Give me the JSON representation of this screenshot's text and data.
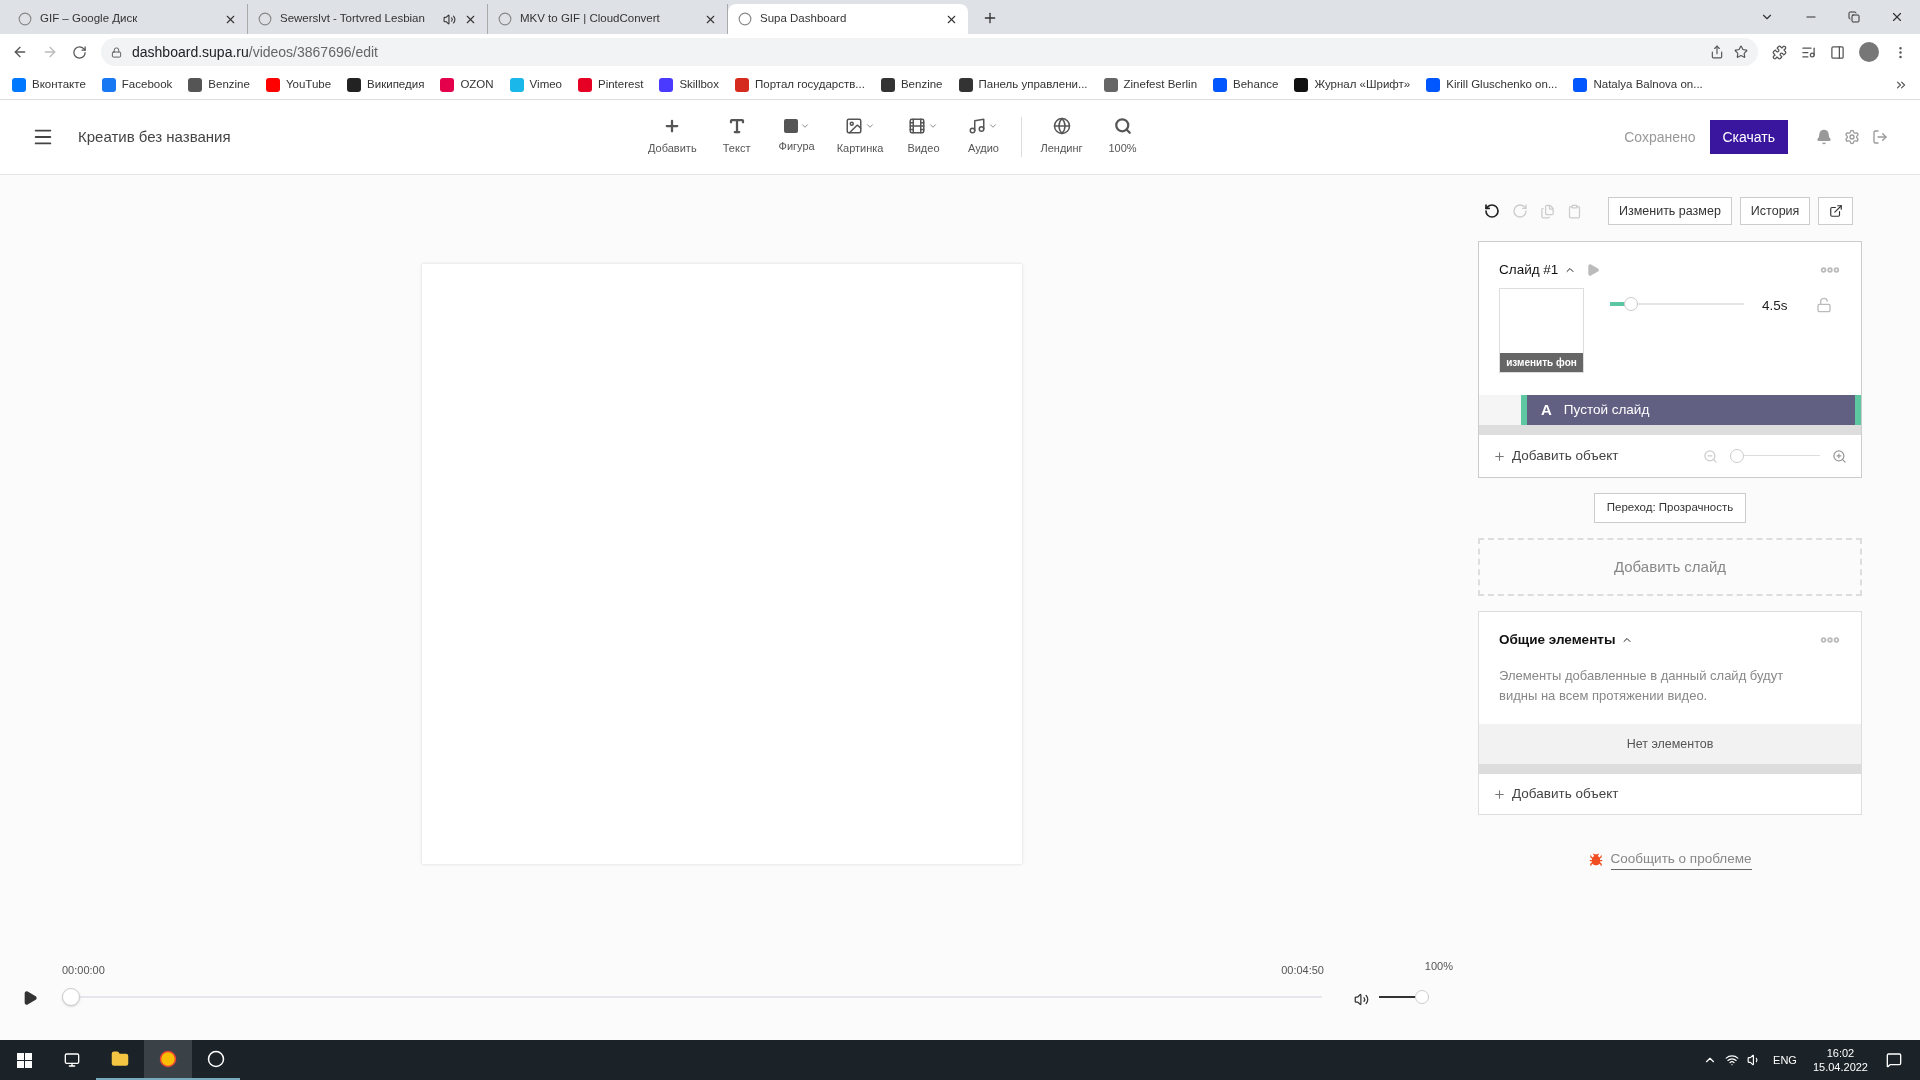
{
  "browser": {
    "tabs": [
      {
        "title": "GIF – Google Диск",
        "selected": false,
        "audio": false
      },
      {
        "title": "Sewerslvt - Tortvred Lesbian",
        "selected": false,
        "audio": true
      },
      {
        "title": "MKV to GIF | CloudConvert",
        "selected": false,
        "audio": false
      },
      {
        "title": "Supa Dashboard",
        "selected": true,
        "audio": false
      }
    ],
    "url_host": "dashboard.supa.ru",
    "url_path": "/videos/3867696/edit",
    "bookmarks": [
      {
        "label": "Вконтакте",
        "color": "#0077ff"
      },
      {
        "label": "Facebook",
        "color": "#1877f2"
      },
      {
        "label": "Benzine",
        "color": "#555555"
      },
      {
        "label": "YouTube",
        "color": "#ff0000"
      },
      {
        "label": "Википедия",
        "color": "#222222"
      },
      {
        "label": "OZON",
        "color": "#e4004b"
      },
      {
        "label": "Vimeo",
        "color": "#1ab7ea"
      },
      {
        "label": "Pinterest",
        "color": "#e60023"
      },
      {
        "label": "Skillbox",
        "color": "#4a3aff"
      },
      {
        "label": "Портал государств...",
        "color": "#d52b1e"
      },
      {
        "label": "Benzine",
        "color": "#333333"
      },
      {
        "label": "Панель управлени...",
        "color": "#333333"
      },
      {
        "label": "Zinefest Berlin",
        "color": "#666666"
      },
      {
        "label": "Behance",
        "color": "#0057ff"
      },
      {
        "label": "Журнал «Шрифт»",
        "color": "#111111"
      },
      {
        "label": "Kirill Gluschenko on...",
        "color": "#0057ff"
      },
      {
        "label": "Natalya Balnova on...",
        "color": "#0057ff"
      }
    ]
  },
  "app": {
    "title": "Креатив без названия",
    "tools": [
      {
        "label": "Добавить",
        "kind": "plus"
      },
      {
        "label": "Текст",
        "kind": "text"
      },
      {
        "label": "Фигура",
        "kind": "shape"
      },
      {
        "label": "Картинка",
        "kind": "image"
      },
      {
        "label": "Видео",
        "kind": "video"
      },
      {
        "label": "Аудио",
        "kind": "audio"
      },
      {
        "label": "Лендинг",
        "kind": "globe"
      },
      {
        "label": "100%",
        "kind": "zoom"
      }
    ],
    "saved": "Сохранено",
    "download": "Скачать"
  },
  "panel": {
    "resize": "Изменить размер",
    "history": "История",
    "slide": {
      "title": "Слайд #1",
      "expanded": true,
      "duration": "4.5s",
      "duration_slider": {
        "level": 0.12
      },
      "change_bg": "изменить фон",
      "layer_letter": "A",
      "layer": "Пустой слайд",
      "add_object": "Добавить объект",
      "zoom_slider": {
        "level": 0.0
      }
    },
    "transition": "Переход: Прозрачность",
    "add_slide": "Добавить слайд",
    "common": {
      "title": "Общие элементы",
      "expanded": true,
      "description": "Элементы добавленные в данный слайд будут видны на всем протяжении видео.",
      "empty": "Нет элементов",
      "add_object": "Добавить объект"
    },
    "report": "Сообщить о проблеме"
  },
  "player": {
    "start": "00:00:00",
    "end": "00:04:50",
    "volume": "100%",
    "level": 0.0,
    "volume_slider": {
      "level": 1.0
    }
  },
  "taskbar": {
    "lang": "ENG",
    "time": "16:02",
    "date": "15.04.2022"
  }
}
